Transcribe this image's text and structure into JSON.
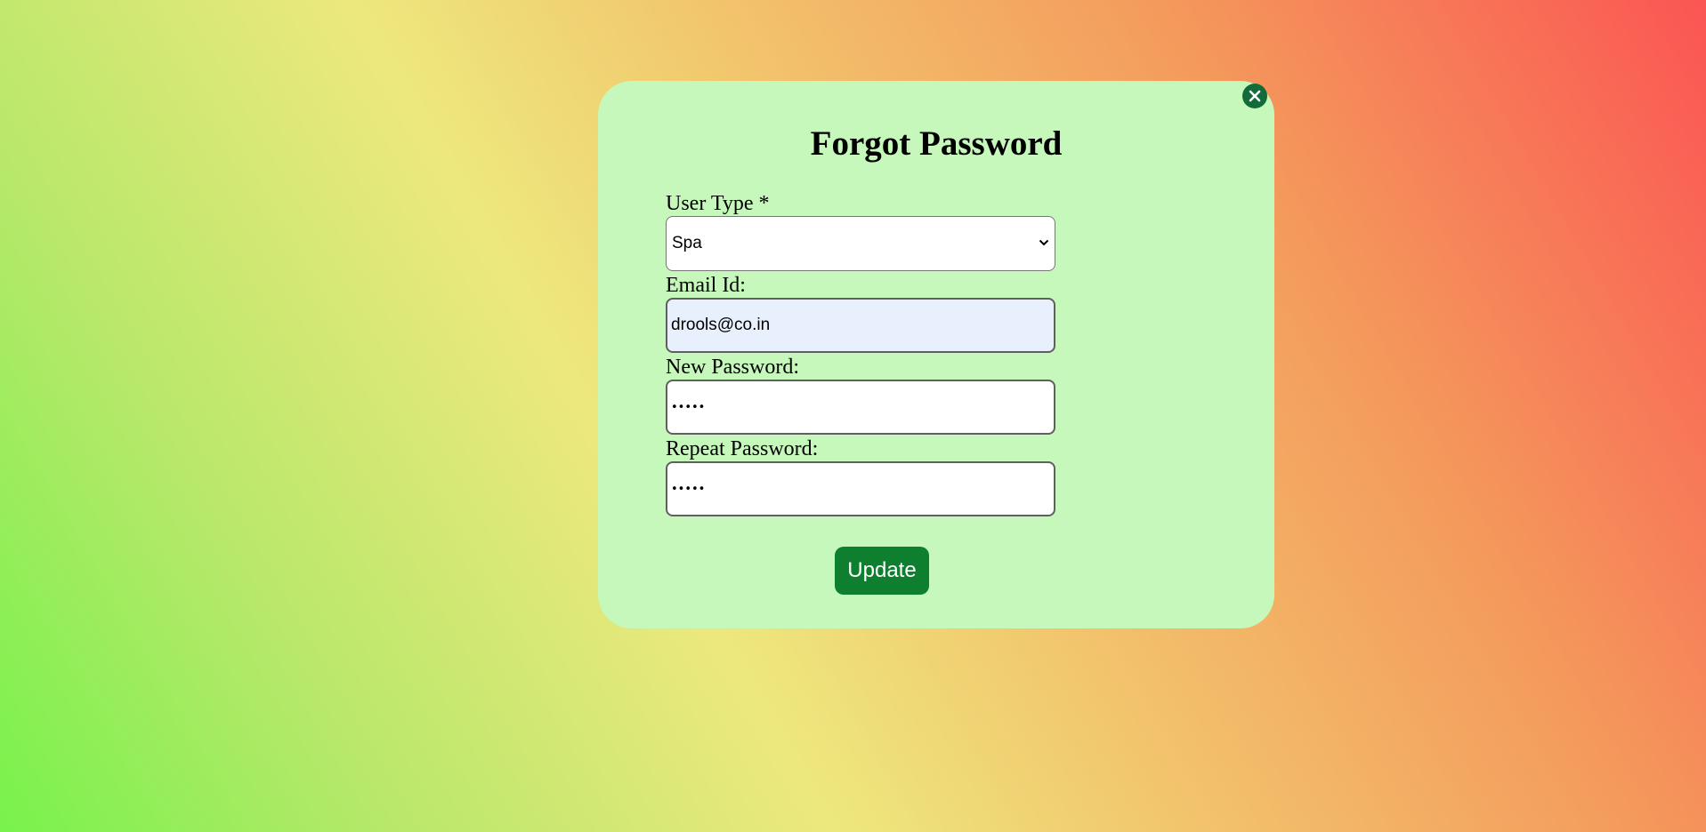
{
  "modal": {
    "title": "Forgot Password",
    "close_icon": "close-circle-icon",
    "fields": {
      "user_type": {
        "label": "User Type *",
        "selected": "Spa"
      },
      "email": {
        "label": "Email Id:",
        "value": "drools@co.in"
      },
      "new_password": {
        "label": "New Password:",
        "masked_value": "•••••"
      },
      "repeat_password": {
        "label": "Repeat Password:",
        "masked_value": "•••••"
      }
    },
    "submit_label": "Update"
  },
  "colors": {
    "modal_background": "#c6f7bb",
    "button": "#0e7e2f",
    "close_button": "#146b3a",
    "autofill_background": "#e8f0fe"
  }
}
